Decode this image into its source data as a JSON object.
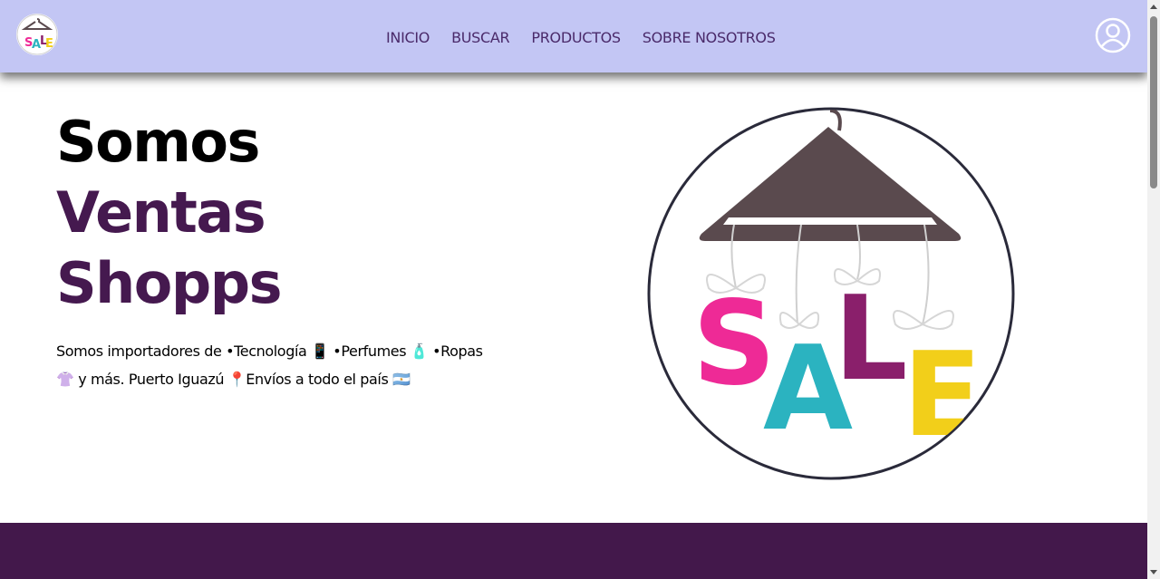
{
  "header": {
    "logo_icon": "sale-hanger-logo",
    "nav": [
      {
        "label": "INICIO"
      },
      {
        "label": "BUSCAR"
      },
      {
        "label": "PRODUCTOS"
      },
      {
        "label": "SOBRE NOSOTROS"
      }
    ],
    "account_icon": "user-circle-icon"
  },
  "hero": {
    "title_line1": "Somos",
    "title_line2": "Ventas",
    "title_line3": "Shopps",
    "description_line1": "Somos importadores de •Tecnología 📱 •Perfumes 🧴 •Ropas",
    "description_line2": "👚 y más. Puerto Iguazú 📍Envíos a todo el país 🇦🇷",
    "image_icon": "sale-hanger-image"
  },
  "colors": {
    "navbar_bg": "#c3c6f4",
    "nav_text": "#4a2a6a",
    "accent_purple": "#45194f",
    "footer_band": "#43184b",
    "sale_pink": "#ee2a96",
    "sale_teal": "#2bb3c0",
    "sale_purple": "#8a1f6b",
    "sale_yellow": "#f2cf1a"
  }
}
